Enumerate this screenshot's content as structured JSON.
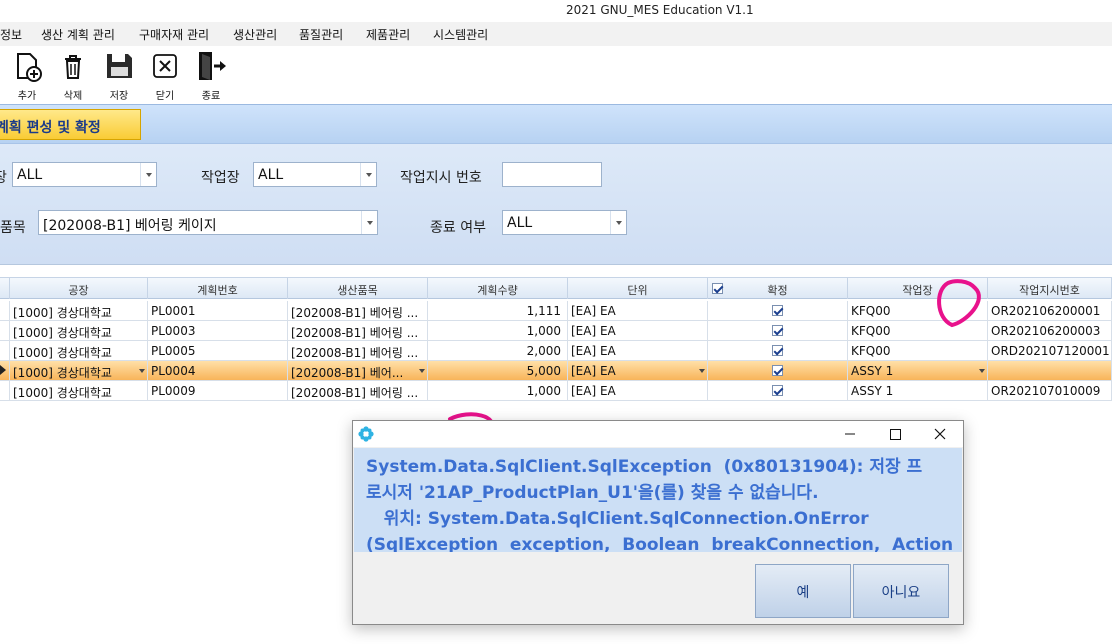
{
  "window": {
    "title": "2021 GNU_MES Education V1.1"
  },
  "menu": [
    "정보",
    "생산 계획 관리",
    "구매자재 관리",
    "생산관리",
    "품질관리",
    "제품관리",
    "시스템관리"
  ],
  "toolbar": [
    {
      "label": "추가",
      "icon": "add-document-icon"
    },
    {
      "label": "삭제",
      "icon": "trash-icon"
    },
    {
      "label": "저장",
      "icon": "floppy-disk-icon"
    },
    {
      "label": "닫기",
      "icon": "close-box-icon"
    },
    {
      "label": "종료",
      "icon": "exit-door-icon"
    }
  ],
  "tab": {
    "label": "계획 편성 및 확정"
  },
  "filters": {
    "plant_label": "장",
    "plant_value": "ALL",
    "workcenter_label": "작업장",
    "workcenter_value": "ALL",
    "workorder_label": "작업지시 번호",
    "workorder_value": "",
    "item_label": "품목",
    "item_value": "[202008-B1] 베어링 케이지",
    "done_label": "종료 여부",
    "done_value": "ALL"
  },
  "grid": {
    "headers": [
      "공장",
      "계획번호",
      "생산품목",
      "계획수량",
      "단위",
      "확정",
      "작업장",
      "작업지시번호"
    ],
    "rows": [
      {
        "plant": "[1000] 경상대학교",
        "plan": "PL0001",
        "item": "[202008-B1] 베어링 ...",
        "qty": "1,111",
        "unit": "[EA] EA",
        "confirmed": true,
        "wc": "KFQ00",
        "order": "OR202106200001",
        "selected": false
      },
      {
        "plant": "[1000] 경상대학교",
        "plan": "PL0003",
        "item": "[202008-B1] 베어링 ...",
        "qty": "1,000",
        "unit": "[EA] EA",
        "confirmed": true,
        "wc": "KFQ00",
        "order": "OR202106200003",
        "selected": false
      },
      {
        "plant": "[1000] 경상대학교",
        "plan": "PL0005",
        "item": "[202008-B1] 베어링 ...",
        "qty": "2,000",
        "unit": "[EA] EA",
        "confirmed": true,
        "wc": "KFQ00",
        "order": "ORD202107120001",
        "selected": false
      },
      {
        "plant": "[1000] 경상대학교",
        "plan": "PL0004",
        "item": "[202008-B1] 베어...",
        "qty": "5,000",
        "unit": "[EA] EA",
        "confirmed": true,
        "wc": "ASSY 1",
        "order": "",
        "selected": true
      },
      {
        "plant": "[1000] 경상대학교",
        "plan": "PL0009",
        "item": "[202008-B1] 베어링 ...",
        "qty": "1,000",
        "unit": "[EA] EA",
        "confirmed": true,
        "wc": "ASSY 1",
        "order": "OR202107010009",
        "selected": false
      }
    ]
  },
  "dialog": {
    "message": "System.Data.SqlClient.SqlException  (0x80131904): 저장 프\n로시저 '21AP_ProductPlan_U1'을(를) 찾을 수 없습니다.\n   위치: System.Data.SqlClient.SqlConnection.OnError\n(SqlException  exception,  Boolean  breakConnection,  Action",
    "yes": "예",
    "no": "아니요"
  },
  "colors": {
    "annotation": "#e8128c",
    "tab": "#f9cc35",
    "header": "#cfe3fb",
    "selected_row": "#f8b45a"
  }
}
